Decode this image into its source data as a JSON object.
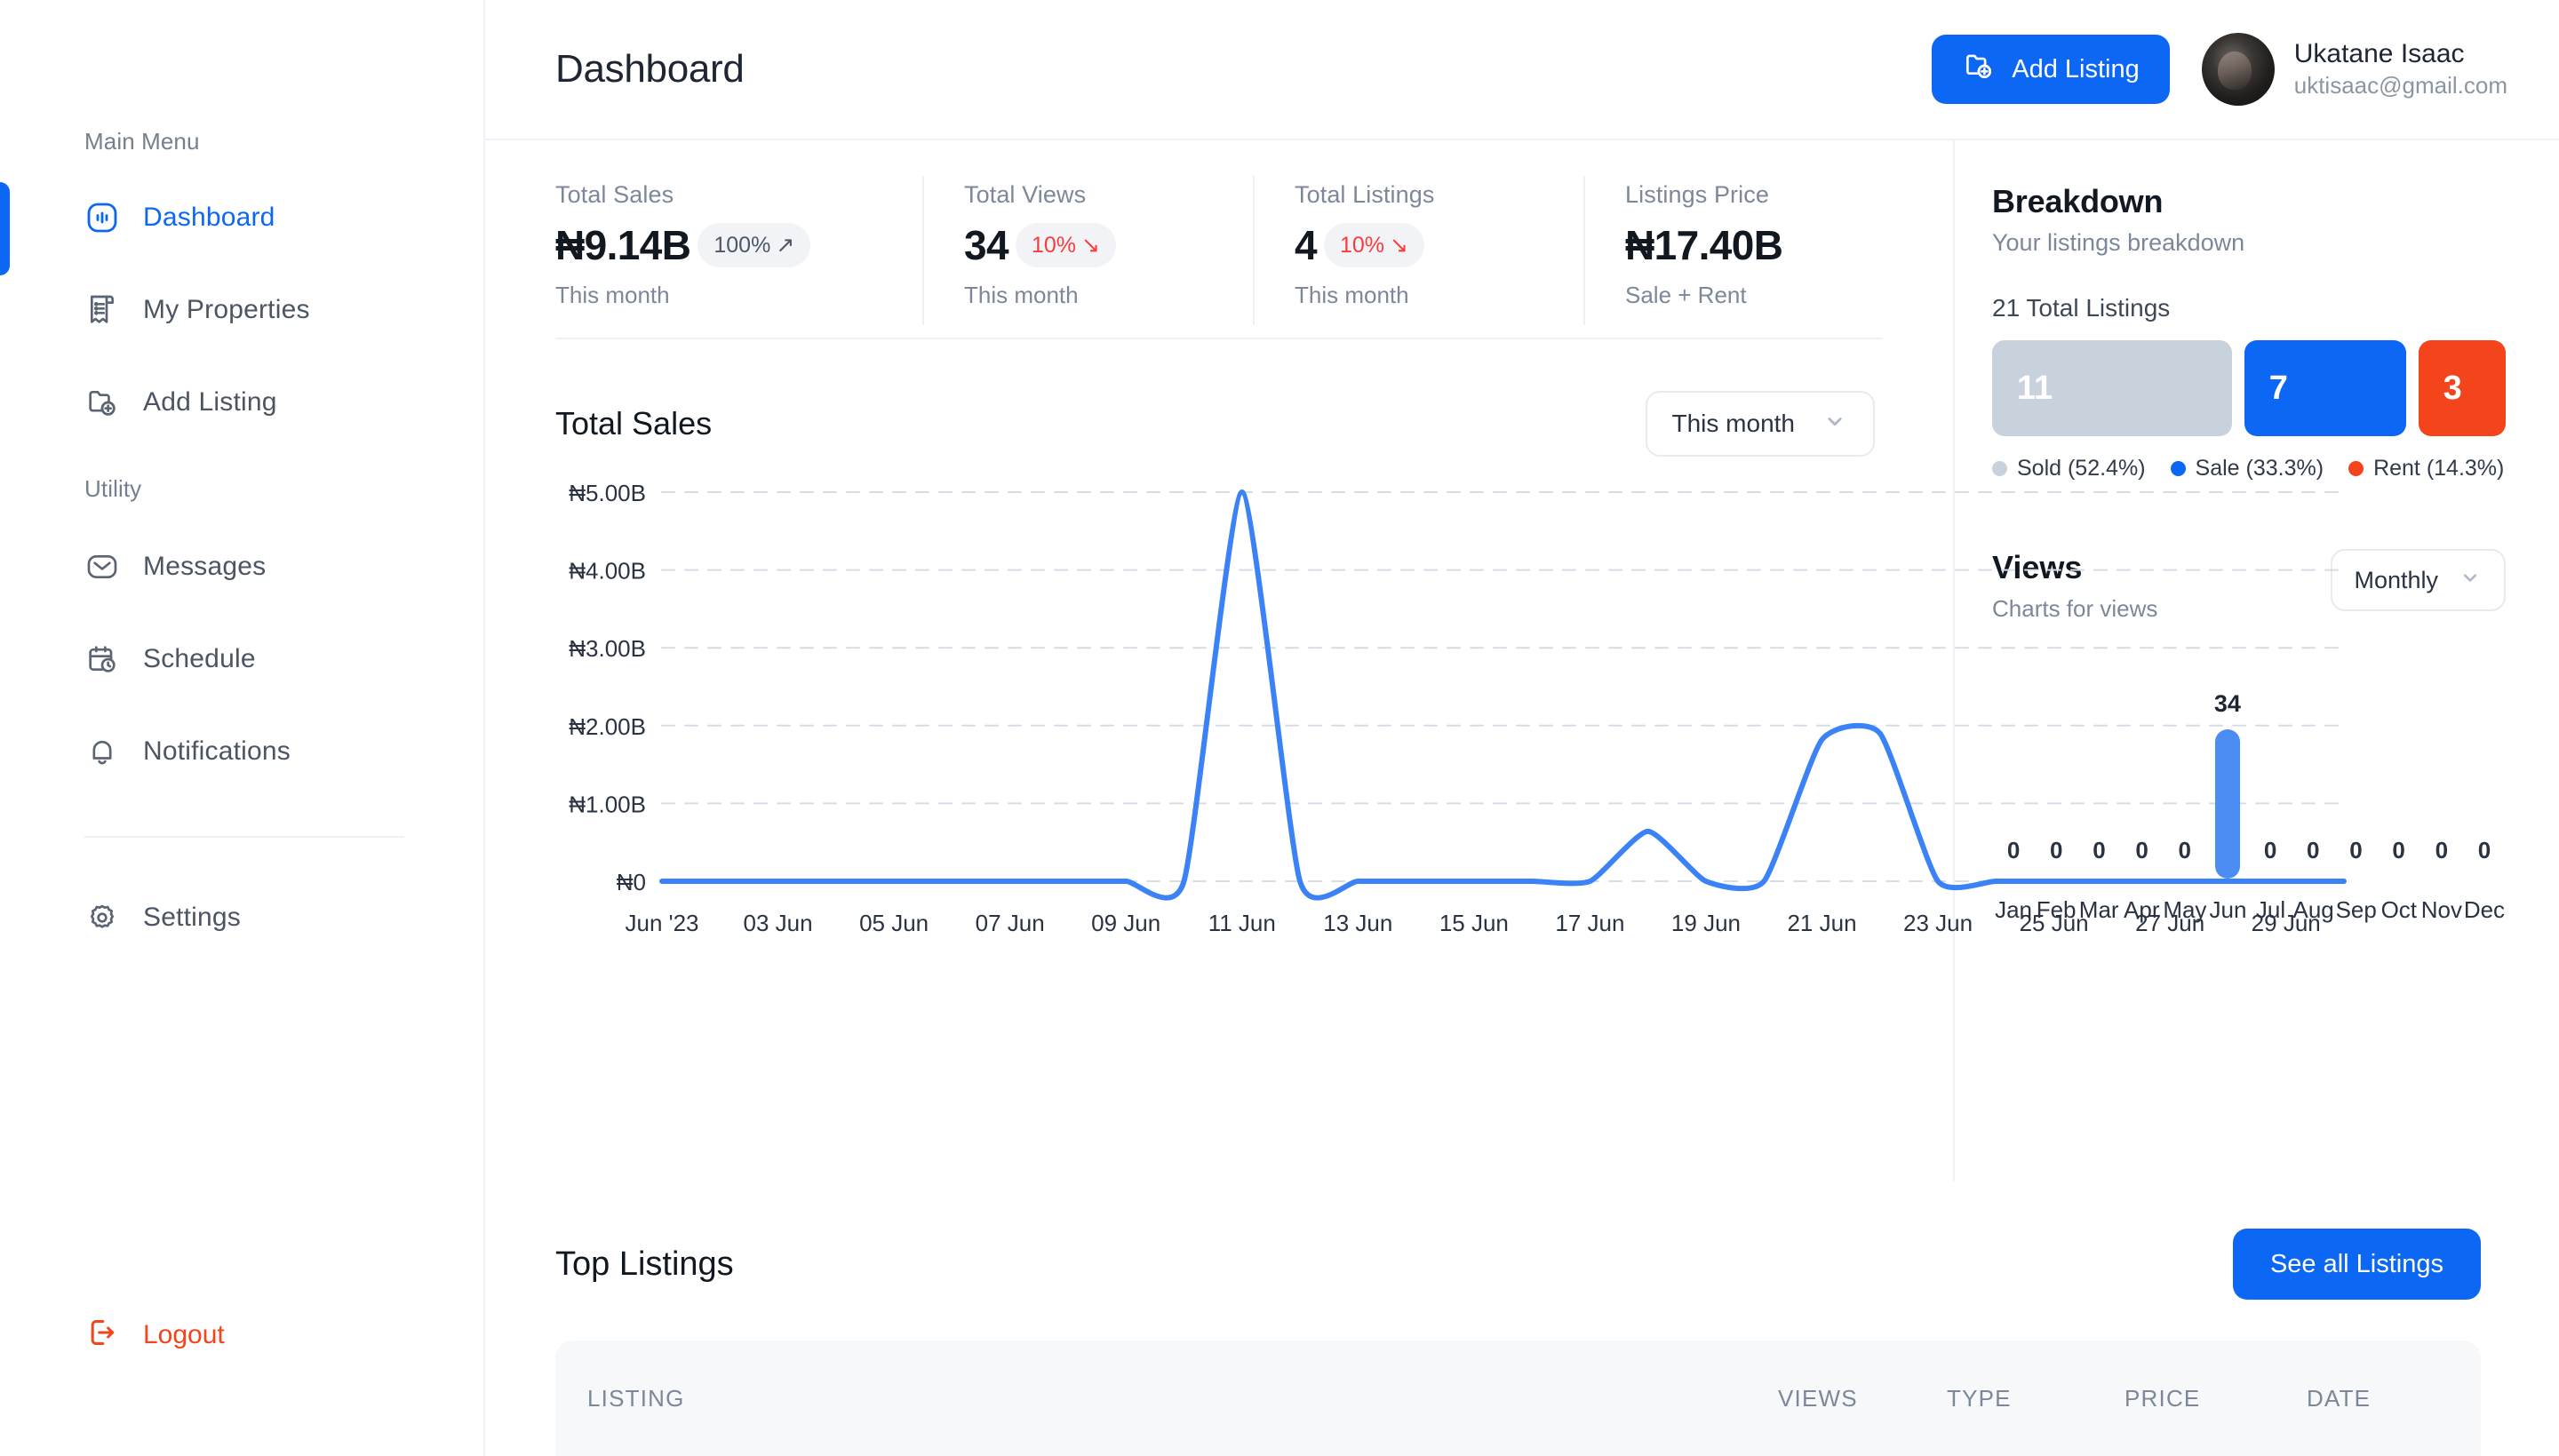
{
  "sidebar": {
    "main_menu_label": "Main Menu",
    "utility_label": "Utility",
    "main_items": [
      {
        "label": "Dashboard",
        "icon": "dashboard-icon",
        "active": true
      },
      {
        "label": "My Properties",
        "icon": "properties-icon",
        "active": false
      },
      {
        "label": "Add Listing",
        "icon": "add-listing-icon",
        "active": false
      }
    ],
    "utility_items": [
      {
        "label": "Messages",
        "icon": "envelope-icon"
      },
      {
        "label": "Schedule",
        "icon": "calendar-clock-icon"
      },
      {
        "label": "Notifications",
        "icon": "bell-icon"
      }
    ],
    "settings": {
      "label": "Settings",
      "icon": "gear-icon"
    },
    "logout": {
      "label": "Logout",
      "icon": "logout-icon"
    }
  },
  "header": {
    "title": "Dashboard",
    "add_listing_label": "Add Listing",
    "user_name": "Ukatane Isaac",
    "user_email": "uktisaac@gmail.com"
  },
  "stats": [
    {
      "label": "Total Sales",
      "value": "₦9.14B",
      "badge": "100%",
      "badge_dir": "up",
      "sub": "This month"
    },
    {
      "label": "Total Views",
      "value": "34",
      "badge": "10%",
      "badge_dir": "down",
      "sub": "This month"
    },
    {
      "label": "Total Listings",
      "value": "4",
      "badge": "10%",
      "badge_dir": "down",
      "sub": "This month"
    },
    {
      "label": "Listings Price",
      "value": "₦17.40B",
      "badge": "",
      "badge_dir": "",
      "sub": "Sale + Rent"
    }
  ],
  "sales_chart": {
    "title": "Total Sales",
    "range_label": "This month"
  },
  "breakdown": {
    "title": "Breakdown",
    "subtitle": "Your listings breakdown",
    "total_label": "21 Total Listings",
    "segments": [
      {
        "name": "Sold",
        "count": "11",
        "percent": "52.4%",
        "legend": "Sold (52.4%)",
        "color": "#C8D2DD",
        "flex": 11
      },
      {
        "name": "Sale",
        "count": "7",
        "percent": "33.3%",
        "legend": "Sale (33.3%)",
        "color": "#0C68F4",
        "flex": 7
      },
      {
        "name": "Rent",
        "count": "3",
        "percent": "14.3%",
        "legend": "Rent (14.3%)",
        "color": "#F4441B",
        "flex": 3.2
      }
    ]
  },
  "views_panel": {
    "title": "Views",
    "subtitle": "Charts for views",
    "range_label": "Monthly"
  },
  "top_listings": {
    "title": "Top Listings",
    "see_all_label": "See all Listings",
    "columns": [
      "LISTING",
      "VIEWS",
      "TYPE",
      "PRICE",
      "DATE"
    ]
  },
  "colors": {
    "accent_blue": "#0C68F4",
    "accent_orange": "#F4441B",
    "muted_gray": "#C8D2DD",
    "bar_blue": "#4C8DF3",
    "down_red": "#FB3B3B"
  },
  "chart_data": [
    {
      "type": "line",
      "title": "Total Sales",
      "xlabel": "",
      "ylabel": "",
      "ylim": [
        0,
        5
      ],
      "grid": true,
      "y_tick_labels": [
        "₦5.00B",
        "₦4.00B",
        "₦3.00B",
        "₦2.00B",
        "₦1.00B",
        "₦0"
      ],
      "y_ticks": [
        5,
        4,
        3,
        2,
        1,
        0
      ],
      "x_tick_labels": [
        "Jun '23",
        "03 Jun",
        "05 Jun",
        "07 Jun",
        "09 Jun",
        "11 Jun",
        "13 Jun",
        "15 Jun",
        "17 Jun",
        "19 Jun",
        "21 Jun",
        "23 Jun",
        "25 Jun",
        "27 Jun",
        "29 Jun"
      ],
      "x": [
        "01 Jun",
        "02 Jun",
        "03 Jun",
        "04 Jun",
        "05 Jun",
        "06 Jun",
        "07 Jun",
        "08 Jun",
        "09 Jun",
        "10 Jun",
        "11 Jun",
        "12 Jun",
        "13 Jun",
        "14 Jun",
        "15 Jun",
        "16 Jun",
        "17 Jun",
        "18 Jun",
        "19 Jun",
        "20 Jun",
        "21 Jun",
        "22 Jun",
        "23 Jun",
        "24 Jun",
        "25 Jun",
        "26 Jun",
        "27 Jun",
        "28 Jun",
        "29 Jun",
        "30 Jun"
      ],
      "values": [
        0,
        0,
        0,
        0,
        0,
        0,
        0,
        0,
        0,
        0,
        5.0,
        0,
        0,
        0,
        0,
        0,
        0,
        0.64,
        0,
        0,
        1.82,
        1.9,
        0,
        0,
        0,
        0,
        0,
        0,
        0,
        0
      ],
      "series_color": "#3B82F6"
    },
    {
      "type": "bar",
      "title": "Views",
      "categories": [
        "Jan",
        "Feb",
        "Mar",
        "Apr",
        "May",
        "Jun",
        "Jul",
        "Aug",
        "Sep",
        "Oct",
        "Nov",
        "Dec"
      ],
      "values": [
        0,
        0,
        0,
        0,
        0,
        34,
        0,
        0,
        0,
        0,
        0,
        0
      ],
      "ylim": [
        0,
        34
      ],
      "grid": false,
      "series_color": "#4C8DF3"
    },
    {
      "type": "bar",
      "title": "Breakdown",
      "orientation": "horizontal",
      "categories": [
        "Sold",
        "Sale",
        "Rent"
      ],
      "values": [
        11,
        7,
        3
      ],
      "percents": [
        52.4,
        33.3,
        14.3
      ],
      "total": 21,
      "colors": [
        "#C8D2DD",
        "#0C68F4",
        "#F4441B"
      ],
      "grid": false
    }
  ]
}
